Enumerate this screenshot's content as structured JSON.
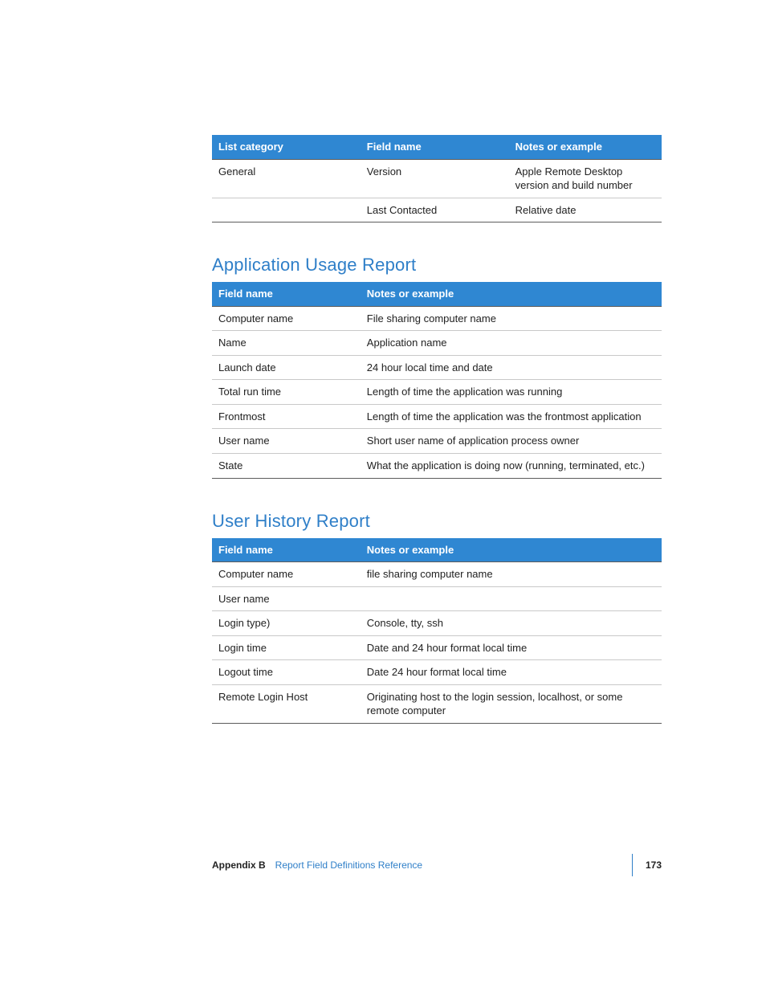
{
  "table1": {
    "headers": [
      "List category",
      "Field name",
      "Notes or example"
    ],
    "rows": [
      [
        "General",
        "Version",
        "Apple Remote Desktop version and build number"
      ],
      [
        "",
        "Last Contacted",
        "Relative date"
      ]
    ]
  },
  "section2": {
    "heading": "Application Usage Report",
    "headers": [
      "Field name",
      "Notes or example"
    ],
    "rows": [
      [
        "Computer name",
        "File sharing computer name"
      ],
      [
        "Name",
        "Application name"
      ],
      [
        "Launch date",
        "24 hour local time and date"
      ],
      [
        "Total run time",
        "Length of time the application was running"
      ],
      [
        "Frontmost",
        "Length of time the application was the frontmost application"
      ],
      [
        "User name",
        "Short user name of application process owner"
      ],
      [
        "State",
        "What the application is doing now (running, terminated, etc.)"
      ]
    ]
  },
  "section3": {
    "heading": "User History Report",
    "headers": [
      "Field name",
      "Notes or example"
    ],
    "rows": [
      [
        "Computer name",
        "file sharing computer name"
      ],
      [
        "User name",
        ""
      ],
      [
        "Login type)",
        "Console, tty, ssh"
      ],
      [
        "Login time",
        "Date and 24 hour format local time"
      ],
      [
        "Logout time",
        "Date 24 hour format local time"
      ],
      [
        "Remote Login Host",
        "Originating host to the login session, localhost, or some remote computer"
      ]
    ]
  },
  "footer": {
    "appendix": "Appendix B",
    "title": "Report Field Definitions Reference",
    "page": "173"
  }
}
